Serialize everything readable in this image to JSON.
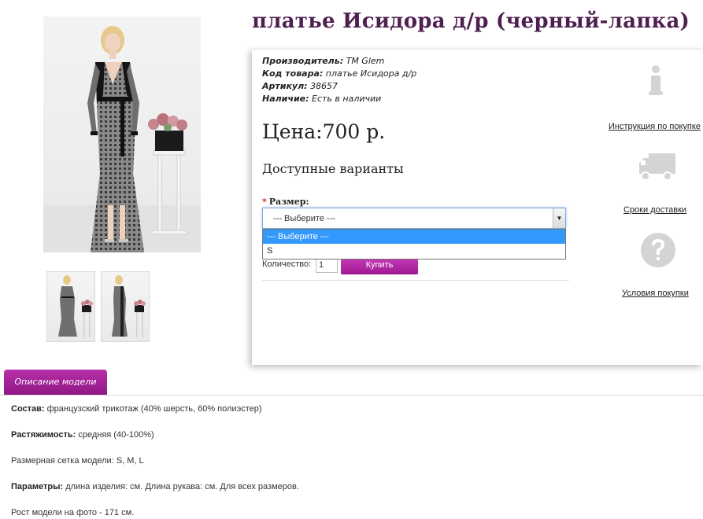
{
  "product": {
    "title": "платье Исидора д/р (черный-лапка)"
  },
  "specs": [
    {
      "label": "Производитель:",
      "value": "ТМ Glem"
    },
    {
      "label": "Код товара:",
      "value": "платье Исидора д/р"
    },
    {
      "label": "Артикул:",
      "value": "38657"
    },
    {
      "label": "Наличие:",
      "value": "Есть в наличии"
    }
  ],
  "price": "Цена:700 р.",
  "variants": {
    "title": "Доступные варианты",
    "size_label": "Размер:",
    "required_mark": "*",
    "selected": "--- Выберите ---",
    "options": [
      "--- Выберите ---",
      "S"
    ]
  },
  "quantity": {
    "label": "Количество:",
    "value": "1"
  },
  "buy_label": "Купить",
  "side_links": {
    "instructions": "Инструкция по покупке",
    "delivery": "Сроки доставки",
    "conditions": "Условия покупки"
  },
  "tabs": {
    "description": "Описание модели"
  },
  "description": [
    {
      "label": "Состав:",
      "value": " французский трикотаж (40% шерсть, 60% полиэстер)"
    },
    {
      "label": "Растяжимость:",
      "value": " средняя (40-100%)"
    },
    {
      "label": "",
      "value": "Размерная сетка модели: S, M, L"
    },
    {
      "label": "Параметры:",
      "value": " длина изделия: см. Длина рукава: см. Для всех размеров."
    },
    {
      "label": "",
      "value": "Рост модели на фото - 171 см."
    }
  ],
  "colors": {
    "title": "#4e1f4f",
    "accent": "#a01a93",
    "selected_option": "#3399ff"
  }
}
